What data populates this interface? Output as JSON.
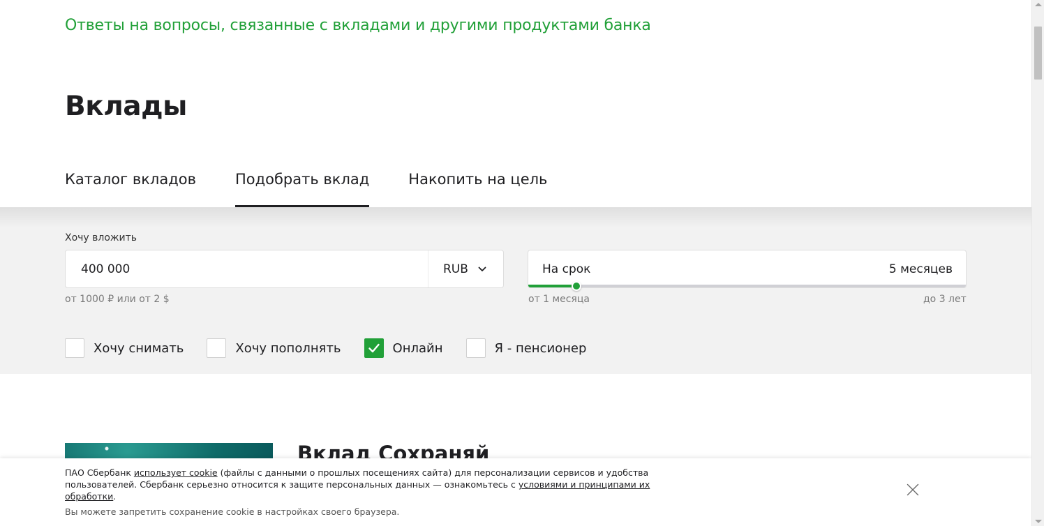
{
  "header": {
    "faq_link": "Ответы на вопросы, связанные с вкладами и другими продуктами банка",
    "title": "Вклады"
  },
  "tabs": [
    {
      "label": "Каталог вкладов",
      "active": false
    },
    {
      "label": "Подобрать вклад",
      "active": true
    },
    {
      "label": "Накопить на цель",
      "active": false
    }
  ],
  "filter": {
    "amount": {
      "label": "Хочу вложить",
      "value": "400 000",
      "currency": "RUB",
      "hint": "от 1000 ₽ или от 2 $"
    },
    "term": {
      "label": "На срок",
      "value": "5 месяцев",
      "min_label": "от 1 месяца",
      "max_label": "до 3 лет",
      "slider_fraction": 0.11
    },
    "checkboxes": [
      {
        "label": "Хочу снимать",
        "checked": false
      },
      {
        "label": "Хочу пополнять",
        "checked": false
      },
      {
        "label": "Онлайн",
        "checked": true
      },
      {
        "label": "Я - пенсионер",
        "checked": false
      }
    ]
  },
  "deposit": {
    "title": "Вклад Сохраняй"
  },
  "cookie": {
    "text_1": "ПАО Сбербанк ",
    "link_1": "использует cookie",
    "text_2": " (файлы с данными о прошлых посещениях сайта) для персонализации сервисов и удобства пользователей. Сбербанк серьезно относится к защите персональных данных — ознакомьтесь с ",
    "link_2": "условиями и принципами их обработки",
    "text_3": ".",
    "note": "Вы можете запретить сохранение cookie в настройках своего браузера."
  },
  "colors": {
    "accent": "#21a038",
    "text": "#1f1f22",
    "panel_bg": "#f2f2f2"
  },
  "icons": {
    "currency_dropdown": "chevron-down-icon",
    "checkbox_checked": "checkmark-icon",
    "cookie_close": "close-icon"
  }
}
